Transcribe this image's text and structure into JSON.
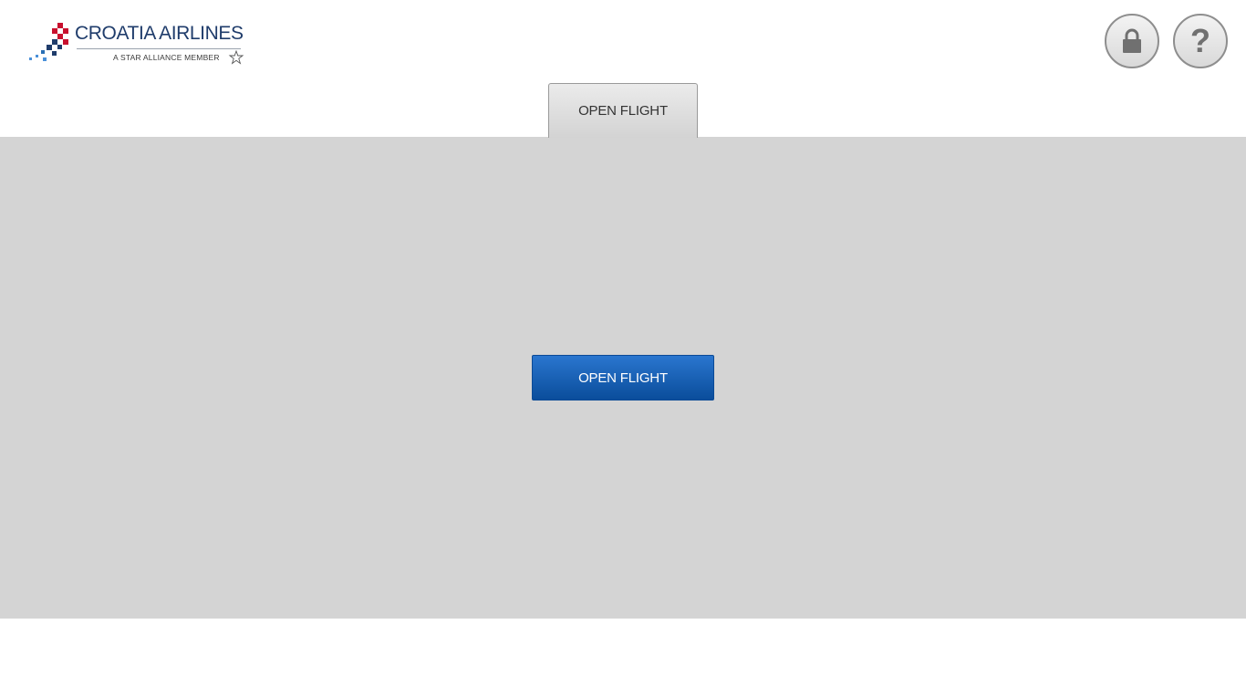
{
  "header": {
    "logo": {
      "name": "CROATIA AIRLINES",
      "tagline": "A STAR ALLIANCE MEMBER",
      "mark_colors": [
        "#c8102e",
        "#1f3c6b",
        "#4a90d9"
      ]
    },
    "lock_button": {
      "icon": "lock-icon"
    },
    "help_button": {
      "icon": "question-mark-icon",
      "glyph": "?"
    }
  },
  "tabs": [
    {
      "label": "OPEN FLIGHT",
      "selected": true
    }
  ],
  "main": {
    "primary_button_label": "OPEN FLIGHT"
  },
  "colors": {
    "panel_background": "#d4d4d4",
    "primary_button": "#1360b8",
    "brand_blue": "#1f3c6b",
    "brand_red": "#c8102e"
  }
}
